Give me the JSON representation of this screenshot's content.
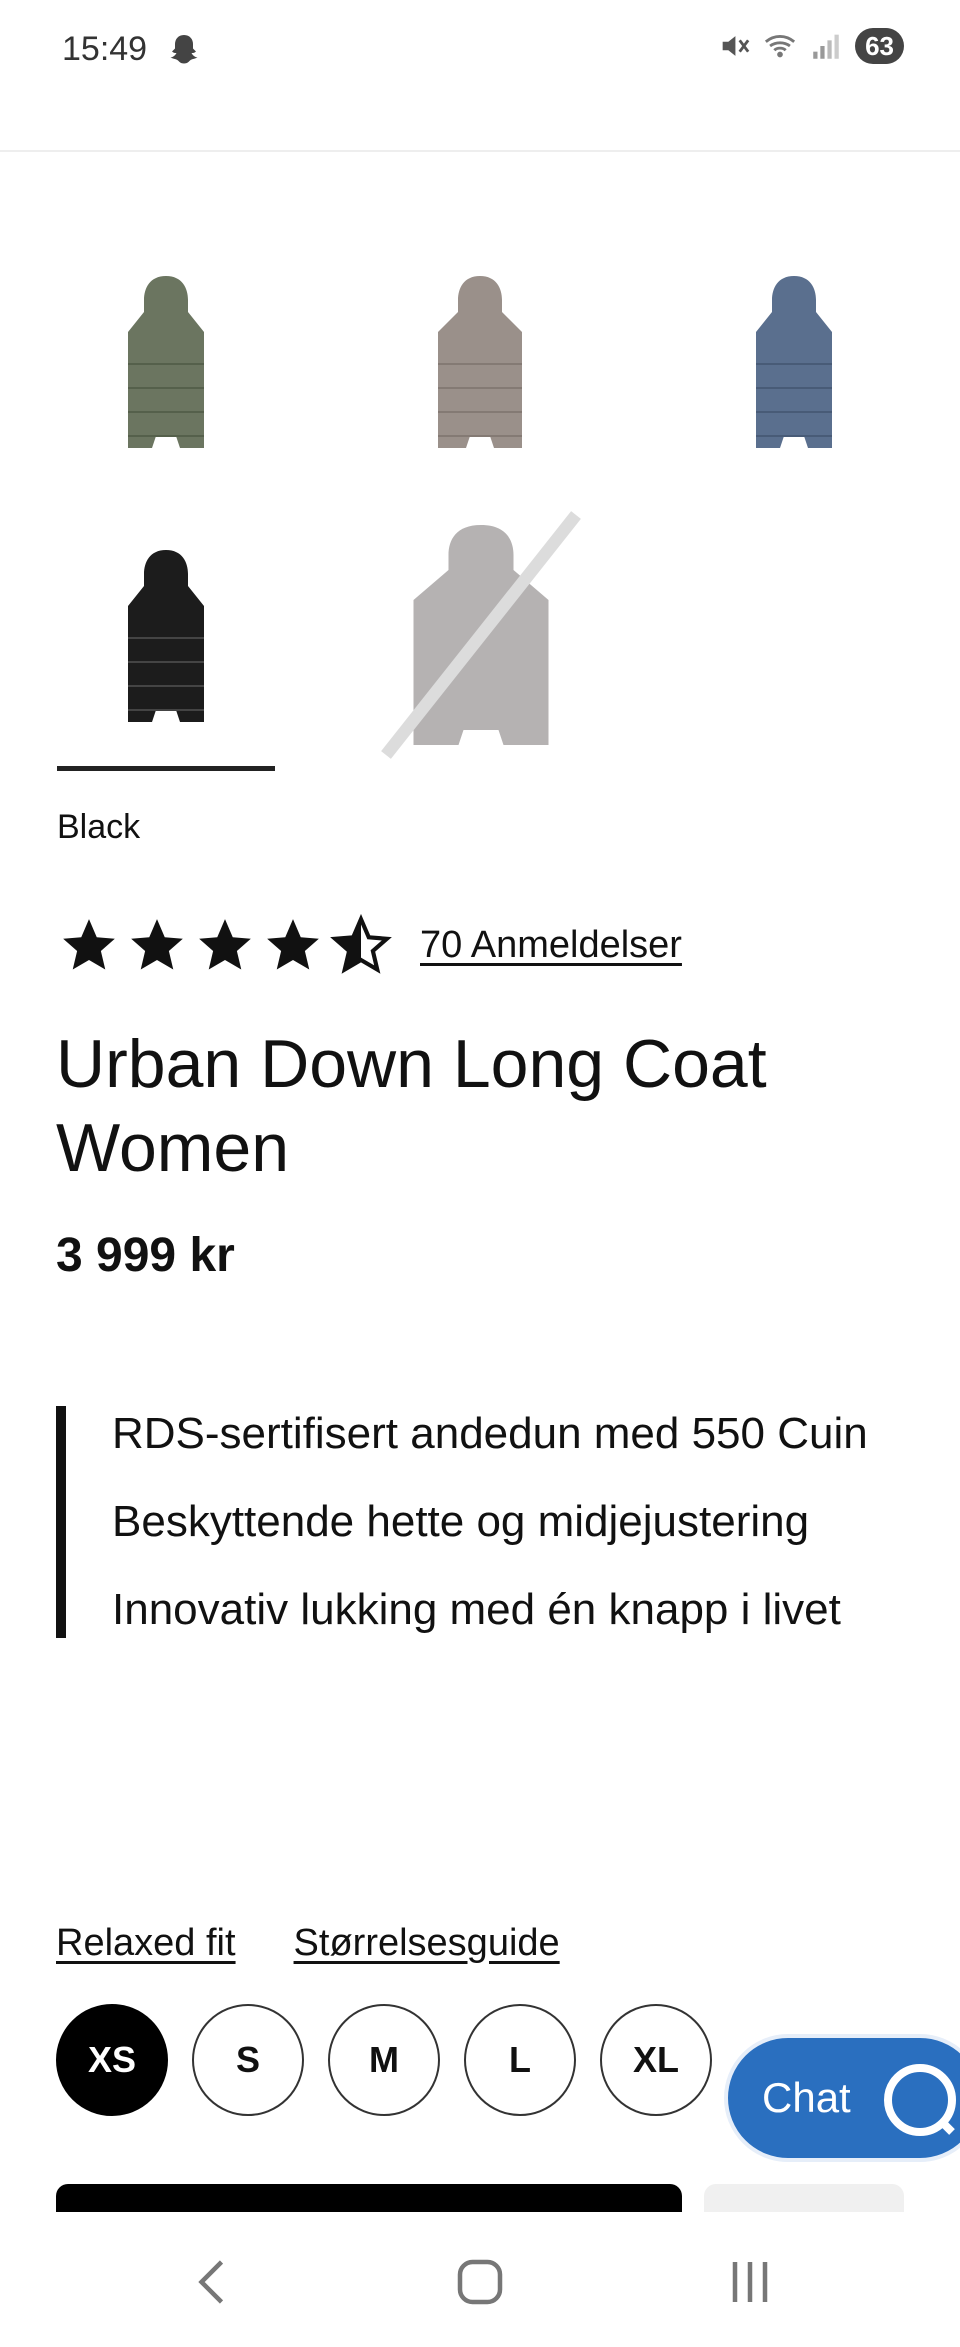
{
  "status_bar": {
    "time": "15:49",
    "battery": "63",
    "icons": [
      "ghost-icon",
      "mute-icon",
      "wifi-icon",
      "signal-icon"
    ]
  },
  "product": {
    "swatches": [
      {
        "name": "green",
        "color": "#6b7560",
        "available": true
      },
      {
        "name": "taupe",
        "color": "#9a908a",
        "available": true
      },
      {
        "name": "blue",
        "color": "#5a6f8e",
        "available": true
      },
      {
        "name": "black",
        "color": "#1c1c1c",
        "available": true,
        "selected": true
      },
      {
        "name": "grey",
        "color": "#9c9898",
        "available": false
      }
    ],
    "selected_color": "Black",
    "rating": {
      "value": 4.5,
      "max": 5,
      "reviews_label": "70 Anmeldelser"
    },
    "title": "Urban Down Long Coat Women",
    "price": "3 999 kr",
    "features": [
      "RDS-sertifisert andedun med 550 Cuin",
      "Beskyttende hette og midjejustering",
      "Innovativ lukking med én knapp i livet"
    ],
    "fit_label": "Relaxed fit",
    "size_guide_label": "Størrelsesguide",
    "sizes": [
      "XS",
      "S",
      "M",
      "L",
      "XL"
    ],
    "selected_size": "XS"
  },
  "chat": {
    "label": "Chat"
  },
  "nav": {
    "icons": [
      "back-icon",
      "home-icon",
      "recents-icon"
    ]
  }
}
